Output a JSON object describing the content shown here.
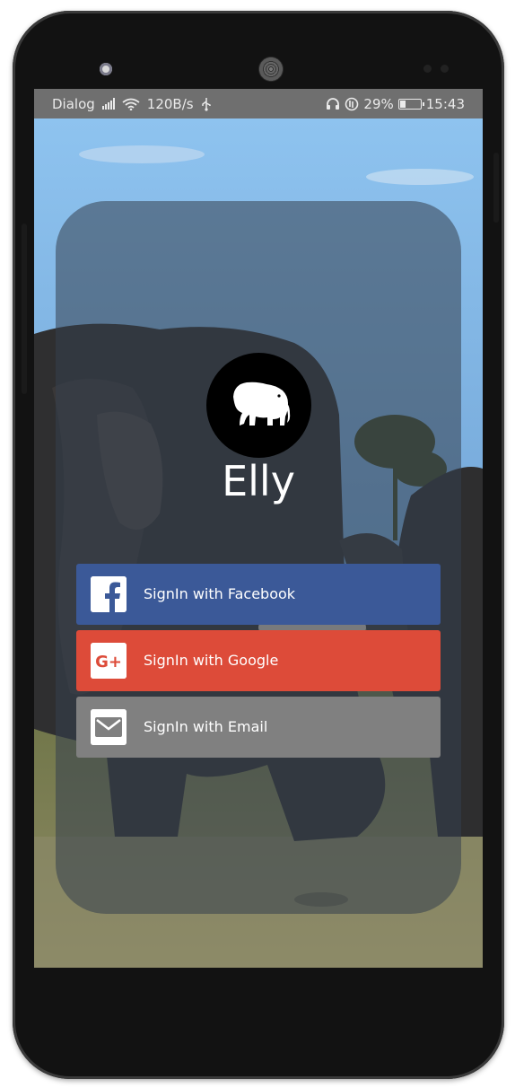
{
  "status_bar": {
    "carrier": "Dialog",
    "speed": "120B/s",
    "battery_percent": "29%",
    "battery_level": 0.29,
    "time": "15:43"
  },
  "app": {
    "title": "Elly",
    "logo_icon": "elephant-icon"
  },
  "signin": {
    "facebook_label": "SignIn with Facebook",
    "google_label": "SignIn with Google",
    "email_label": "SignIn with Email",
    "facebook_color": "#3b5998",
    "google_color": "#dd4b39",
    "email_color": "#808080"
  }
}
